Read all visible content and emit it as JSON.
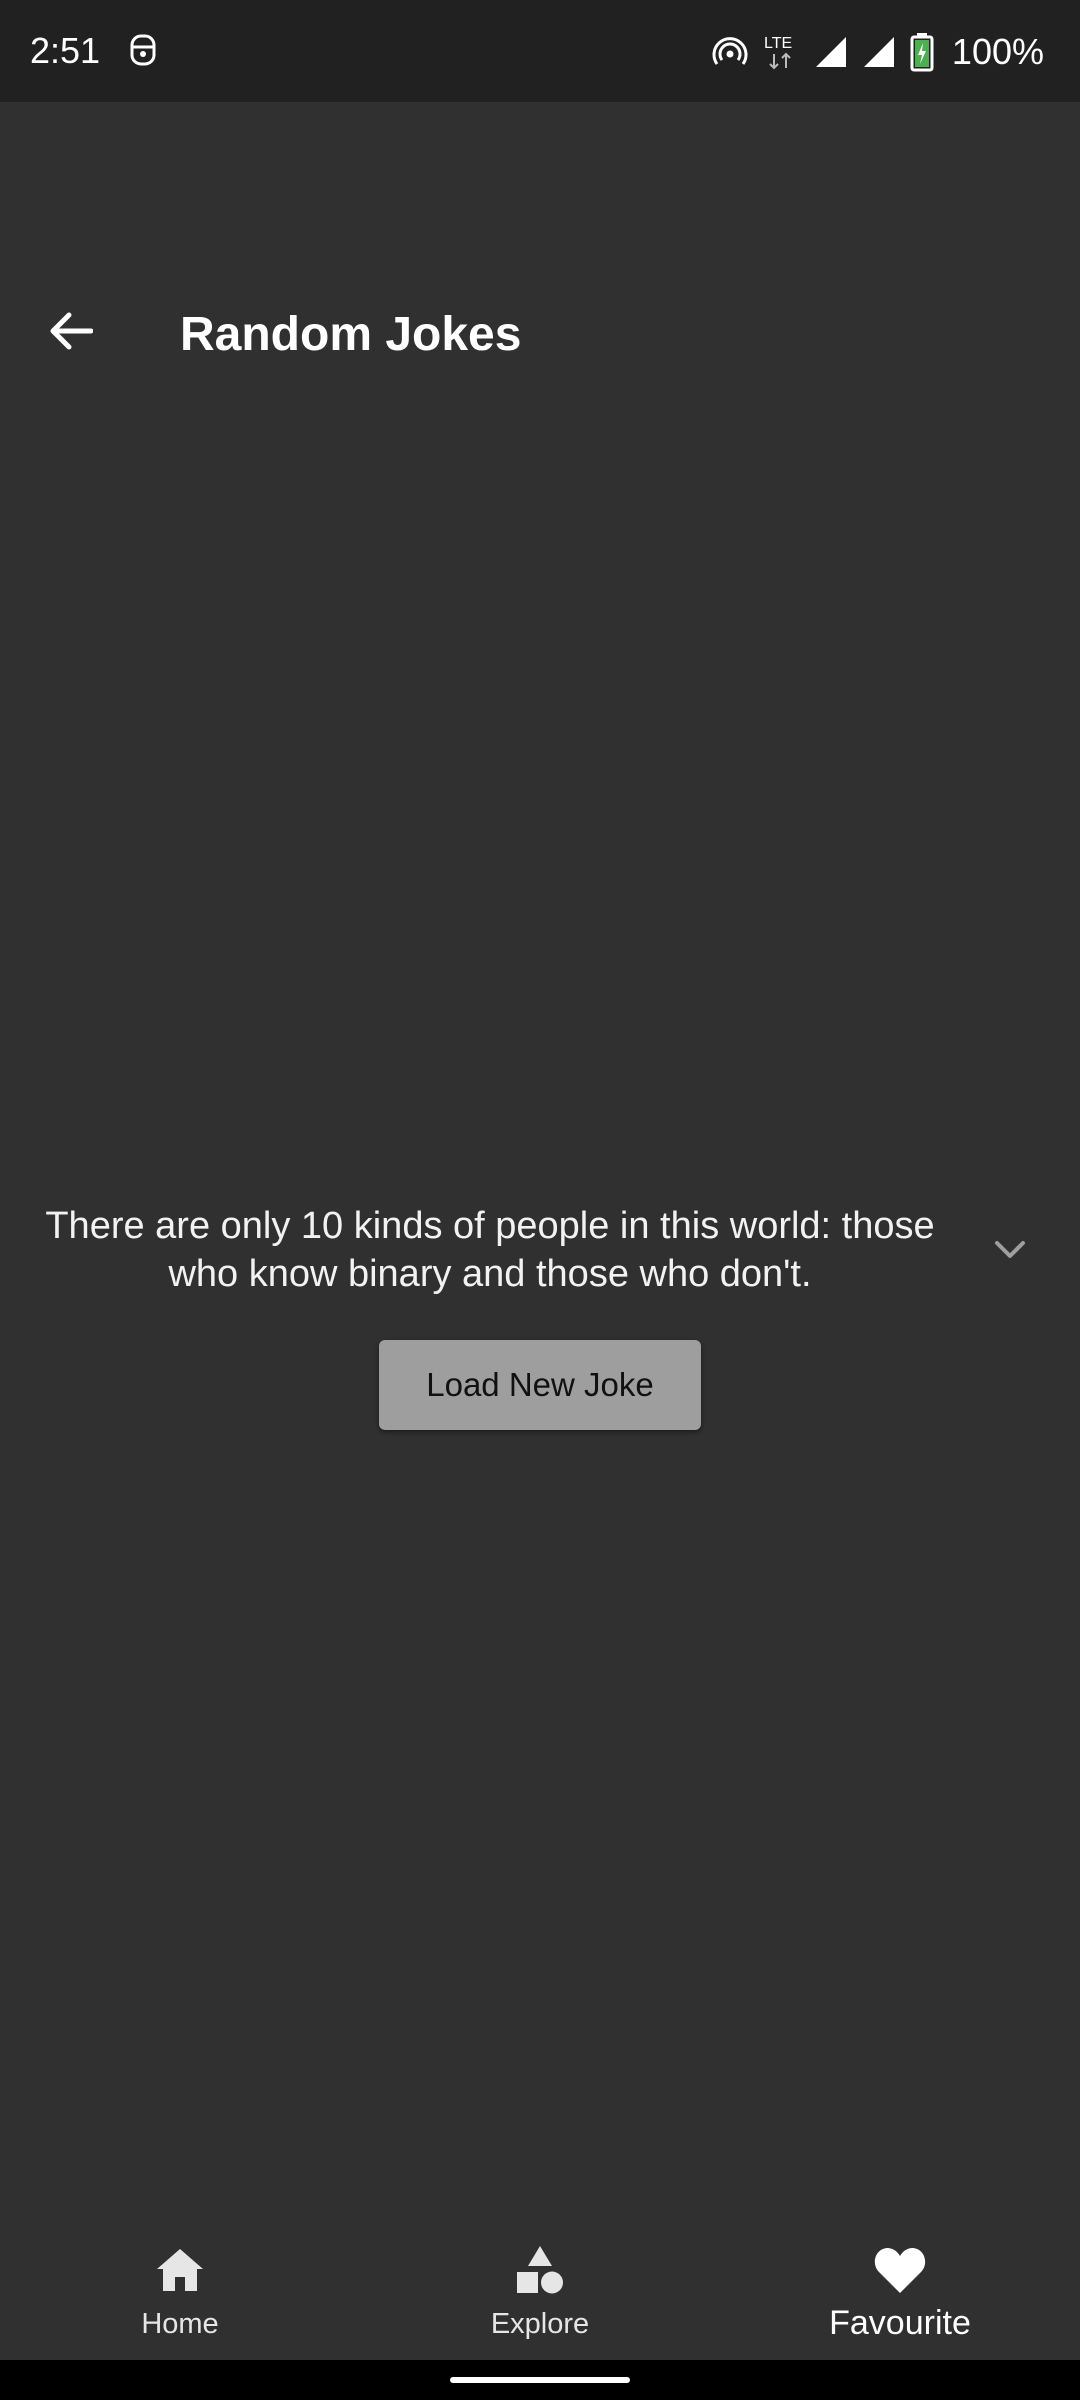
{
  "status_bar": {
    "time": "2:51",
    "network_label": "LTE",
    "battery": "100%"
  },
  "header": {
    "title": "Random Jokes"
  },
  "joke": {
    "text": "There are only 10 kinds of people in this world: those who know binary and those who don't.",
    "load_button_label": "Load New Joke"
  },
  "bottom_nav": {
    "items": [
      {
        "label": "Home",
        "icon": "home-icon"
      },
      {
        "label": "Explore",
        "icon": "shapes-icon"
      },
      {
        "label": "Favourite",
        "icon": "heart-icon",
        "active": true
      }
    ]
  },
  "colors": {
    "background": "#303030",
    "status_bar": "#212121",
    "button": "#9e9e9e",
    "battery_fill": "#4caf50"
  }
}
